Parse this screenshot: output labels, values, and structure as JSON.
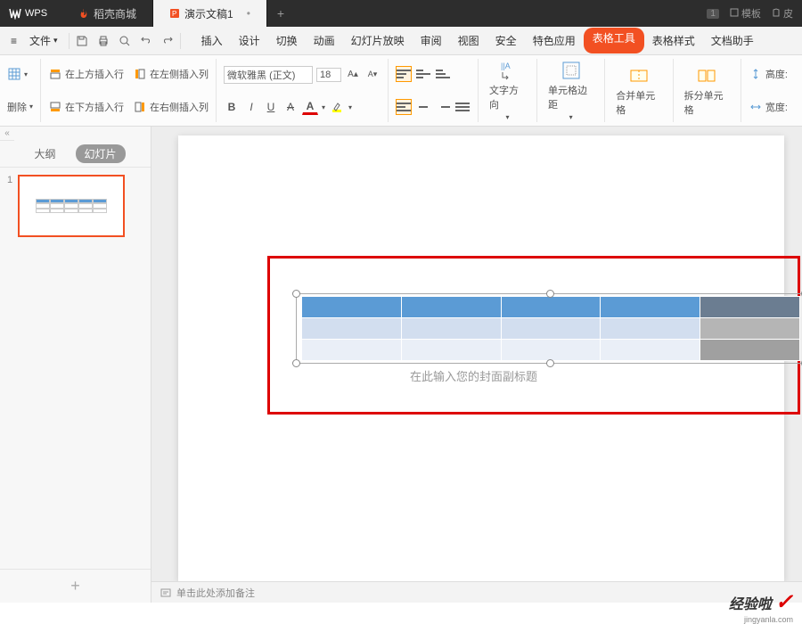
{
  "titlebar": {
    "logo": "WPS",
    "tabs": [
      {
        "label": "稻壳商城",
        "icon": "fire"
      },
      {
        "label": "演示文稿1",
        "icon": "ppt",
        "active": true
      }
    ],
    "add": "+",
    "badge": "1",
    "templates": "模板",
    "skin": "皮"
  },
  "menubar": {
    "hamburger": "≡",
    "file": "文件",
    "tabs": [
      "插入",
      "设计",
      "切换",
      "动画",
      "幻灯片放映",
      "审阅",
      "视图",
      "安全",
      "特色应用"
    ],
    "tool_tab": "表格工具",
    "after_tabs": [
      "表格样式",
      "文档助手"
    ]
  },
  "ribbon": {
    "delete": "删除",
    "insert_row_above": "在上方插入行",
    "insert_row_below": "在下方插入行",
    "insert_col_left": "在左侧插入列",
    "insert_col_right": "在右侧插入列",
    "font_name": "微软雅黑 (正文)",
    "font_size": "18",
    "bold": "B",
    "italic": "I",
    "underline": "U",
    "strike": "A",
    "fontcolor": "A",
    "text_direction": "文字方向",
    "cell_margin": "单元格边距",
    "merge_cells": "合并单元格",
    "split_cells": "拆分单元格",
    "height": "高度:",
    "width": "宽度:"
  },
  "thumbs": {
    "outline": "大纲",
    "slides": "幻灯片",
    "collapse": "«",
    "num1": "1",
    "add": "+"
  },
  "slide": {
    "placeholder": "在此输入您的封面副标题"
  },
  "notes": {
    "prompt": "单击此处添加备注"
  },
  "watermark": {
    "text": "经验啦",
    "url": "jingyanla.com"
  },
  "chart_data": {
    "type": "table",
    "rows": 3,
    "cols": 5,
    "note": "empty table object selected on slide; last column highlighted"
  }
}
